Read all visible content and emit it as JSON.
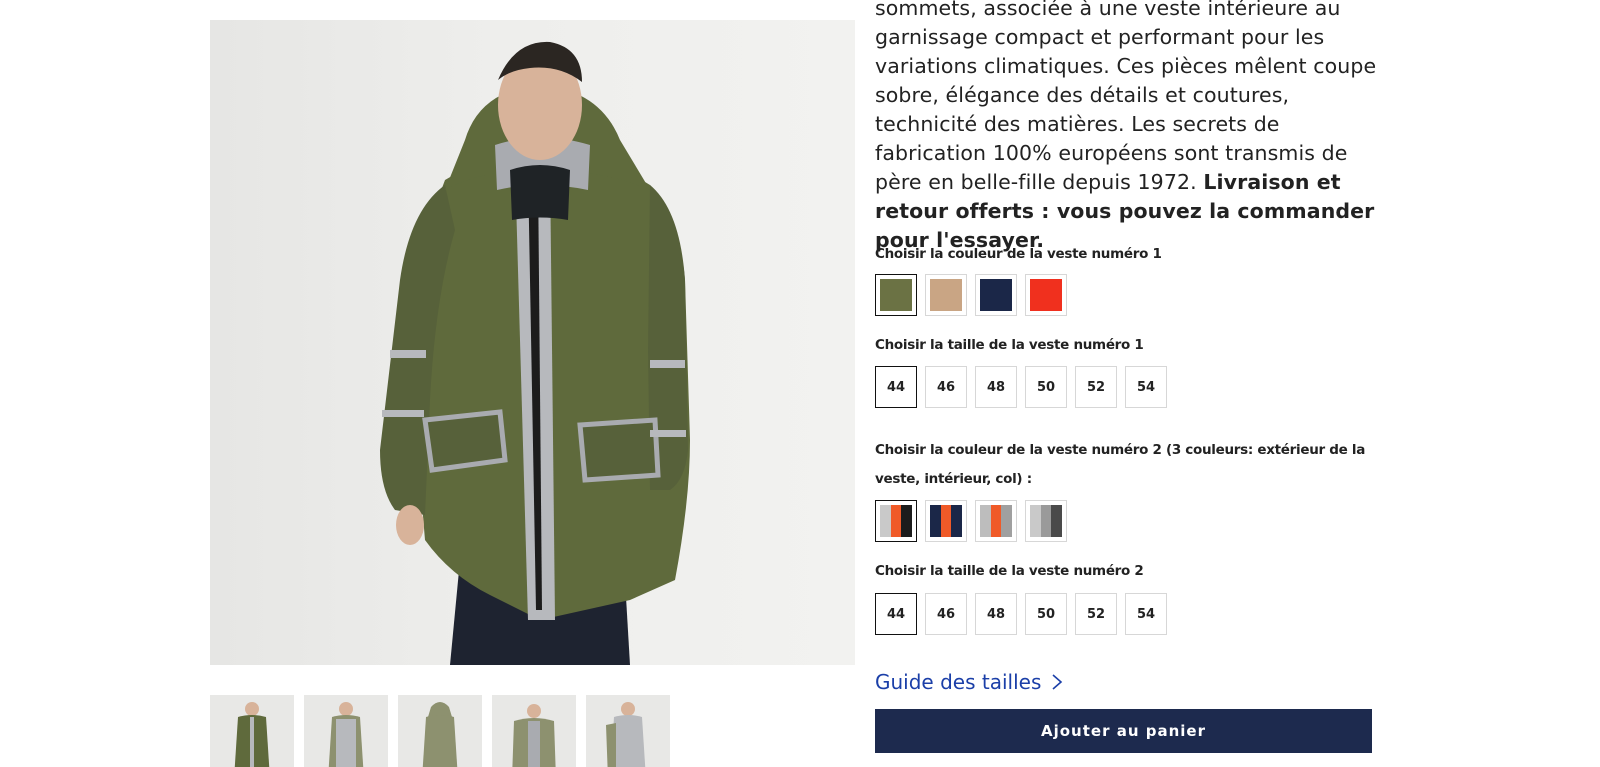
{
  "description": {
    "text": "sommets, associée à une veste intérieure au garnissage compact et performant pour les variations climatiques. Ces pièces mêlent coupe sobre, élégance des détails et coutures, technicité des matières. Les secrets de fabrication 100% européens sont transmis de père en belle-fille depuis 1972.",
    "bold": "Livraison et retour offerts : vous pouvez la commander pour l'essayer."
  },
  "jacket1": {
    "color_label": "Choisir la couleur de la veste numéro 1",
    "colors": [
      {
        "name": "olive",
        "swatch": [
          "#6b7244"
        ],
        "selected": true
      },
      {
        "name": "camel",
        "swatch": [
          "#c9a584"
        ],
        "selected": false
      },
      {
        "name": "navy",
        "swatch": [
          "#1b2748"
        ],
        "selected": false
      },
      {
        "name": "red",
        "swatch": [
          "#f0301e"
        ],
        "selected": false
      }
    ],
    "size_label": "Choisir la taille de la veste numéro 1",
    "sizes": [
      "44",
      "46",
      "48",
      "50",
      "52",
      "54"
    ],
    "selected_size": "44"
  },
  "jacket2": {
    "color_label": "Choisir la couleur de la veste numéro 2 (3 couleurs: extérieur de la veste, intérieur, col) :",
    "colors": [
      {
        "name": "grey-orange-black",
        "swatch": [
          "#c9c9c9",
          "#f05a28",
          "#1c1c1c"
        ],
        "selected": true
      },
      {
        "name": "navy-orange-navy",
        "swatch": [
          "#1b2748",
          "#f05a28",
          "#1b2748"
        ],
        "selected": false
      },
      {
        "name": "grey-orange-grey",
        "swatch": [
          "#bdbdbd",
          "#f05a28",
          "#a0a0a0"
        ],
        "selected": false
      },
      {
        "name": "grey-grey-charcoal",
        "swatch": [
          "#c9c9c9",
          "#9a9a9a",
          "#4a4a4a"
        ],
        "selected": false
      }
    ],
    "size_label": "Choisir la taille de la veste numéro 2",
    "sizes": [
      "44",
      "46",
      "48",
      "50",
      "52",
      "54"
    ],
    "selected_size": "44"
  },
  "guide_label": "Guide des tailles",
  "add_to_cart_label": "Ajouter au panier",
  "colors": {
    "link": "#1b3fa8",
    "button": "#1d2a4e",
    "jacket": "#5f6a3c"
  },
  "icons": {
    "guide": "chevron-right-icon"
  }
}
